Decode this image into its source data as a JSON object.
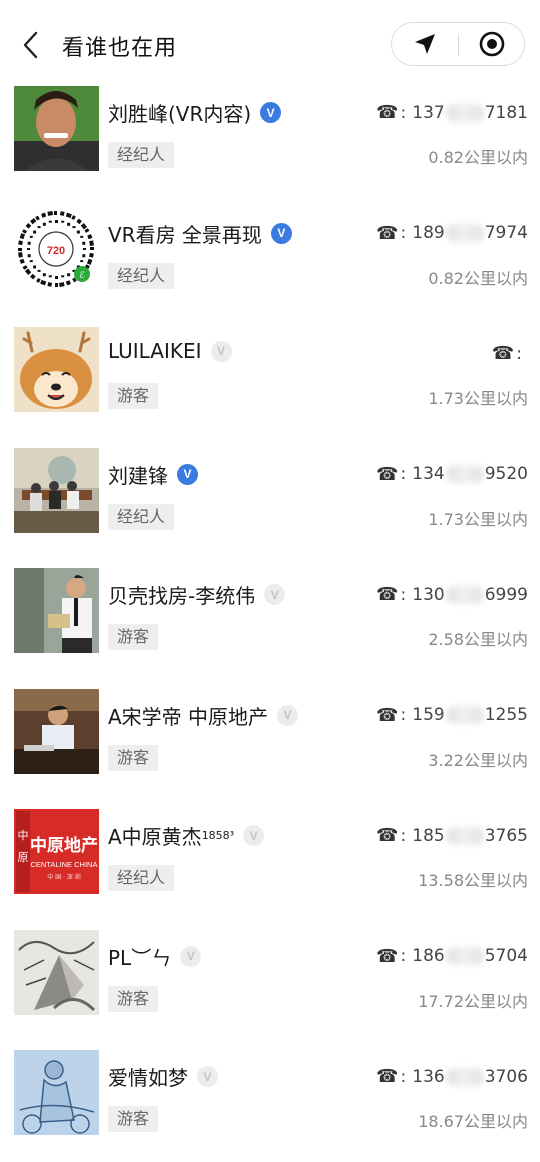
{
  "header": {
    "title": "看谁也在用"
  },
  "users": [
    {
      "name": "刘胜峰(VR内容)",
      "verified": true,
      "tag": "经纪人",
      "phone_prefix": "137",
      "phone_suffix": "7181",
      "distance": "0.82公里以内",
      "avatar": "portrait-man-smiling"
    },
    {
      "name": "VR看房 全景再现",
      "verified": true,
      "tag": "经纪人",
      "phone_prefix": "189",
      "phone_suffix": "7974",
      "distance": "0.82公里以内",
      "avatar": "mini-program-code",
      "avatar_text": "720"
    },
    {
      "name": "LUILAIKEI",
      "verified": false,
      "tag": "游客",
      "phone_prefix": "",
      "phone_suffix": "",
      "distance": "1.73公里以内",
      "avatar": "shiba-dog-antlers"
    },
    {
      "name": "刘建锋",
      "verified": true,
      "tag": "经纪人",
      "phone_prefix": "134",
      "phone_suffix": "9520",
      "distance": "1.73公里以内",
      "avatar": "meeting-room-photo"
    },
    {
      "name": "贝壳找房-李统伟",
      "verified": false,
      "tag": "游客",
      "phone_prefix": "130",
      "phone_suffix": "6999",
      "distance": "2.58公里以内",
      "avatar": "man-reading-book"
    },
    {
      "name": "A宋学帝  中原地产",
      "verified": false,
      "tag": "游客",
      "phone_prefix": "159",
      "phone_suffix": "1255",
      "distance": "3.22公里以内",
      "avatar": "man-at-desk"
    },
    {
      "name": "A中原黄杰",
      "name_sup": "1858³",
      "verified": false,
      "tag": "经纪人",
      "phone_prefix": "185",
      "phone_suffix": "3765",
      "distance": "13.58公里以内",
      "avatar": "centaline-logo",
      "avatar_text": "中原地产",
      "avatar_subtext": "CENTALINE CHINA",
      "avatar_vertical": "中原"
    },
    {
      "name": "PL︶ㄣ",
      "verified": false,
      "tag": "游客",
      "phone_prefix": "186",
      "phone_suffix": "5704",
      "distance": "17.72公里以内",
      "avatar": "pencil-sketch"
    },
    {
      "name": "爱情如梦",
      "verified": false,
      "tag": "游客",
      "phone_prefix": "136",
      "phone_suffix": "3706",
      "distance": "18.67公里以内",
      "avatar": "blue-sketch"
    }
  ],
  "colors": {
    "verified_badge": "#3a7be0",
    "unverified_badge": "#ececec",
    "tag_bg": "#eeeeee",
    "centaline_red": "#d62b27"
  },
  "icons": {
    "back": "chevron-left-icon",
    "location": "location-arrow-icon",
    "close": "target-circle-icon",
    "phone": "telephone-icon",
    "verified": "v-badge-icon"
  }
}
